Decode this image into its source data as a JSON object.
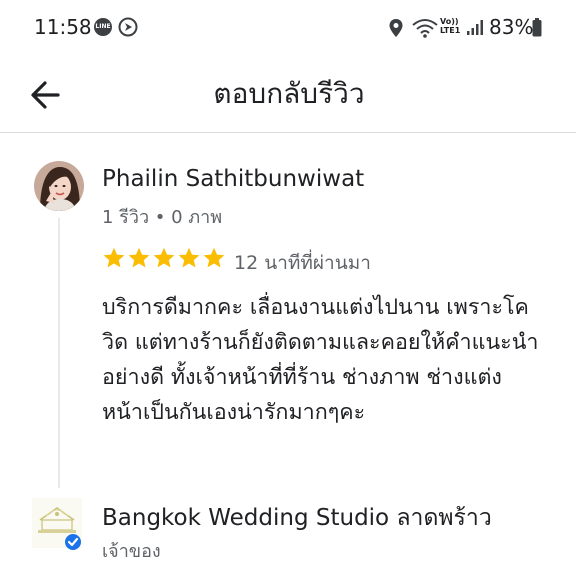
{
  "status_bar": {
    "time": "11:58",
    "line_badge": "LINE",
    "volte_line1": "Vo))",
    "volte_line2": "LTE1",
    "battery": "83%"
  },
  "header": {
    "title": "ตอบกลับรีวิว",
    "back_icon": "arrow-back-icon"
  },
  "review": {
    "reviewer_name": "Phailin Sathitbunwiwat",
    "reviewer_meta": "1 รีวิว • 0 ภาพ",
    "rating": 5,
    "time_ago": "12 นาทีที่ผ่านมา",
    "text": "บริการดีมากคะ เลื่อนงานแต่งไปนาน เพราะโควิด แต่ทางร้านก็ยังติดตามและคอยให้คำแนะนำอย่างดี ทั้งเจ้าหน้าที่ที่ร้าน ช่างภาพ ช่างแต่งหน้าเป็นกันเองน่ารักมากๆคะ"
  },
  "owner": {
    "name": "Bangkok Wedding Studio ลาดพร้าว",
    "role": "เจ้าของ"
  },
  "colors": {
    "star": "#fbbc04",
    "verified": "#1a73e8",
    "secondary_text": "#5f6368"
  }
}
